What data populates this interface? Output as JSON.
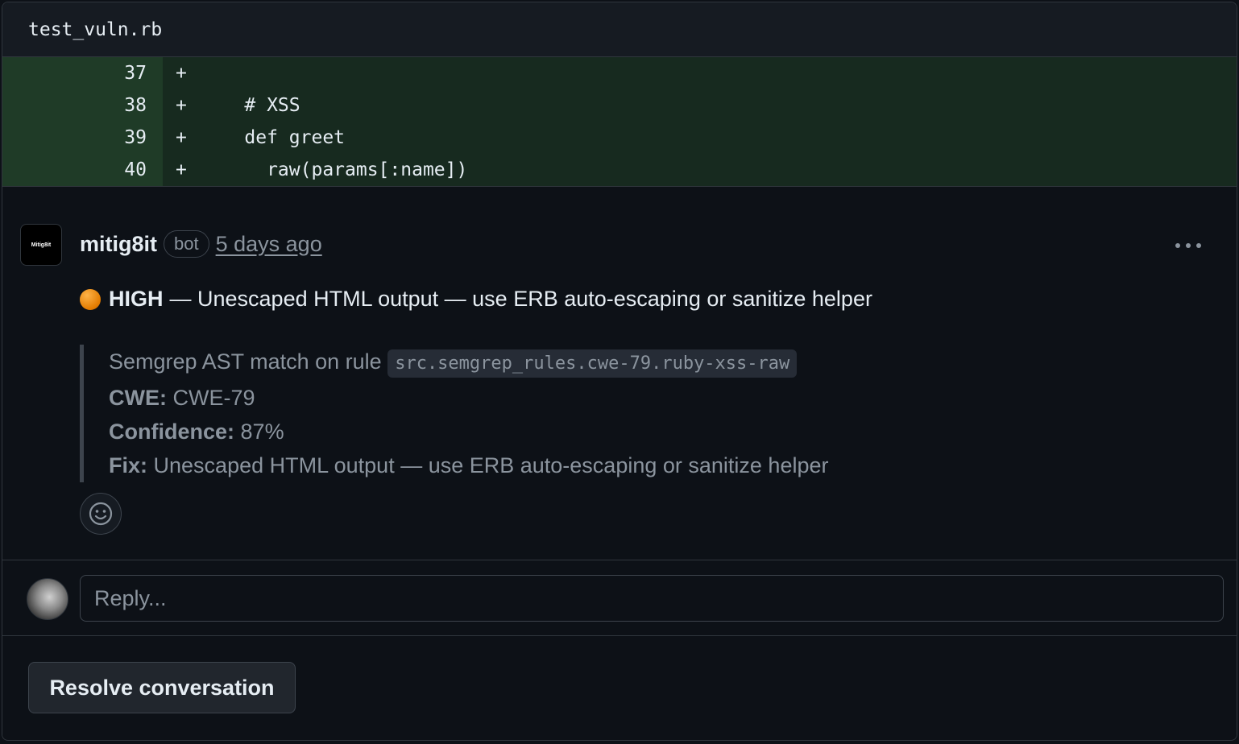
{
  "file": {
    "name": "test_vuln.rb"
  },
  "diff": {
    "lines": [
      {
        "num": "37",
        "marker": "+",
        "code": ""
      },
      {
        "num": "38",
        "marker": "+",
        "code": "    # XSS"
      },
      {
        "num": "39",
        "marker": "+",
        "code": "    def greet"
      },
      {
        "num": "40",
        "marker": "+",
        "code": "      raw(params[:name])"
      }
    ]
  },
  "comment": {
    "avatar_text": "Mitig8it",
    "author": "mitig8it",
    "badge": "bot",
    "timestamp": "5 days ago",
    "severity_icon": "orange-circle-icon",
    "severity_color": "#f0883e",
    "severity": "HIGH",
    "headline": "— Unescaped HTML output — use ERB auto-escaping or sanitize helper",
    "detail": {
      "match_prefix": "Semgrep AST match on rule",
      "rule_id": "src.semgrep_rules.cwe-79.ruby-xss-raw",
      "cwe_label": "CWE:",
      "cwe_value": "CWE-79",
      "confidence_label": "Confidence:",
      "confidence_value": "87%",
      "fix_label": "Fix:",
      "fix_value": "Unescaped HTML output — use ERB auto-escaping or sanitize helper"
    }
  },
  "reply": {
    "placeholder": "Reply..."
  },
  "footer": {
    "resolve_label": "Resolve conversation"
  },
  "colors": {
    "background": "#0d1117",
    "diff_add_code": "#172a1f",
    "diff_add_gutter": "#1f3b27",
    "border": "#30363d"
  }
}
